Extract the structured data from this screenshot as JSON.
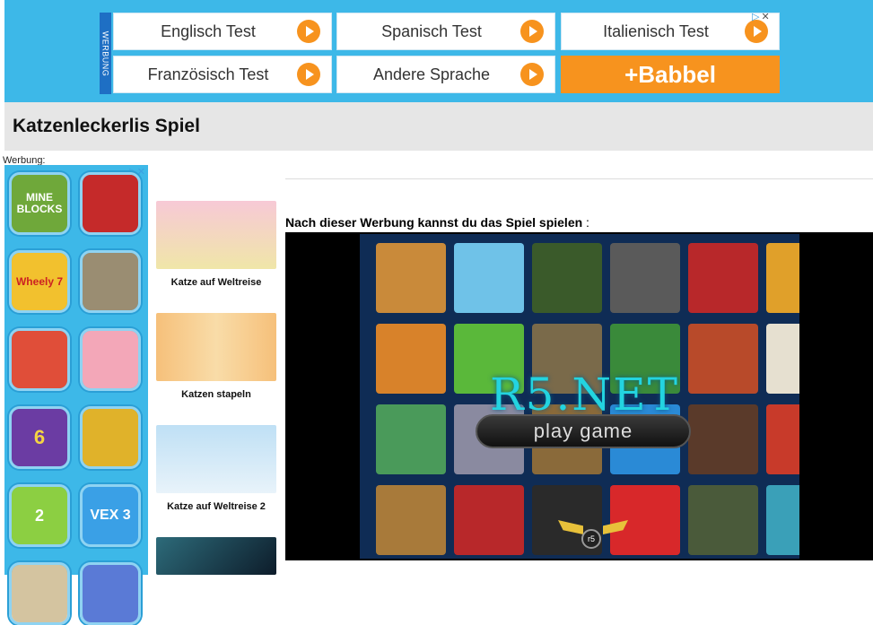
{
  "top_ad": {
    "werbung_label": "WERBUNG",
    "buttons": [
      {
        "label": "Englisch Test"
      },
      {
        "label": "Spanisch Test"
      },
      {
        "label": "Italienisch Test"
      },
      {
        "label": "Französisch Test"
      },
      {
        "label": "Andere Sprache"
      }
    ],
    "babbel_label": "+Babbel",
    "adchoices": "▷",
    "close": "✕"
  },
  "page": {
    "title": "Katzenleckerlis Spiel",
    "werbung": "Werbung:"
  },
  "left_ad": {
    "adchoices": "▷✕",
    "tiles": [
      {
        "label": "MINE BLOCKS",
        "icon": "mine-blocks-icon",
        "color": "#6fa83a"
      },
      {
        "label": "",
        "icon": "spiderman-icon",
        "color": "#c52a2a"
      },
      {
        "label": "Wheely 7",
        "icon": "wheely-icon",
        "color": "#f2c12e"
      },
      {
        "label": "",
        "icon": "talking-dog-icon",
        "color": "#9a8d72"
      },
      {
        "label": "",
        "icon": "subway-surfer-icon",
        "color": "#e04e39"
      },
      {
        "label": "",
        "icon": "nurse-doctor-icon",
        "color": "#f3a7b8"
      },
      {
        "label": "6",
        "icon": "food-game-icon",
        "color": "#6b3ca3"
      },
      {
        "label": "",
        "icon": "taxi-car-icon",
        "color": "#e0b22a"
      },
      {
        "label": "2",
        "icon": "om-nom-icon",
        "color": "#8ccf42"
      },
      {
        "label": "VEX 3",
        "icon": "vex-icon",
        "color": "#3aa0e6"
      }
    ]
  },
  "games": [
    {
      "name": "Katze auf Weltreise",
      "color": "#f5b7c8"
    },
    {
      "name": "Katzen stapeln",
      "color": "#f6c07a"
    },
    {
      "name": "Katze auf Weltreise 2",
      "color": "#aed6f1"
    },
    {
      "name": "",
      "color": "#1d3b52"
    }
  ],
  "main": {
    "notice": "Nach dieser Werbung kannst du das Spiel spielen",
    "notice_colon": " :",
    "video": {
      "brand": "R5.NET",
      "play_label": "play game",
      "badge": "r5"
    }
  }
}
